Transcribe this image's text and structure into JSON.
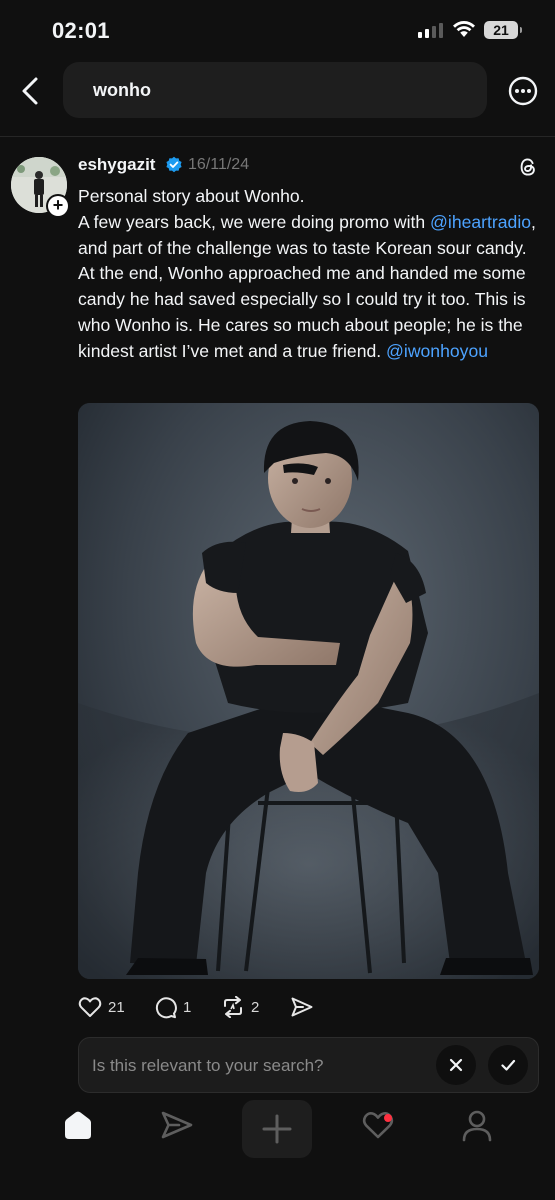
{
  "status_bar": {
    "time": "02:01",
    "battery": "21"
  },
  "search": {
    "query": "wonho"
  },
  "post": {
    "author": "eshygazit",
    "date": "16/11/24",
    "title_line": "Personal story about Wonho.",
    "text_1": "A few years back, we were doing promo with ",
    "mention_1": "@iheartradio",
    "text_2": ", and part of the challenge was to taste Korean sour candy. At the end, Wonho approached me and handed me some candy he had saved especially so I could try it too. This is who Wonho is. He cares so much about people; he is the kindest artist I’ve met and a true friend. ",
    "mention_2": "@iwonhoyou",
    "likes": "21",
    "replies": "1",
    "reposts": "2"
  },
  "relevance_prompt": {
    "question": "Is this relevant to your search?"
  },
  "colors": {
    "background": "#101010",
    "mention": "#4da3ff",
    "verified": "#1d9bf0",
    "notification": "#ff3040"
  },
  "icons": [
    "back-icon",
    "more-icon",
    "verified-icon",
    "threads-logo-icon",
    "heart-icon",
    "reply-icon",
    "repost-icon",
    "share-icon",
    "close-icon",
    "check-icon",
    "home-icon",
    "send-icon",
    "plus-icon",
    "activity-icon",
    "profile-icon"
  ]
}
